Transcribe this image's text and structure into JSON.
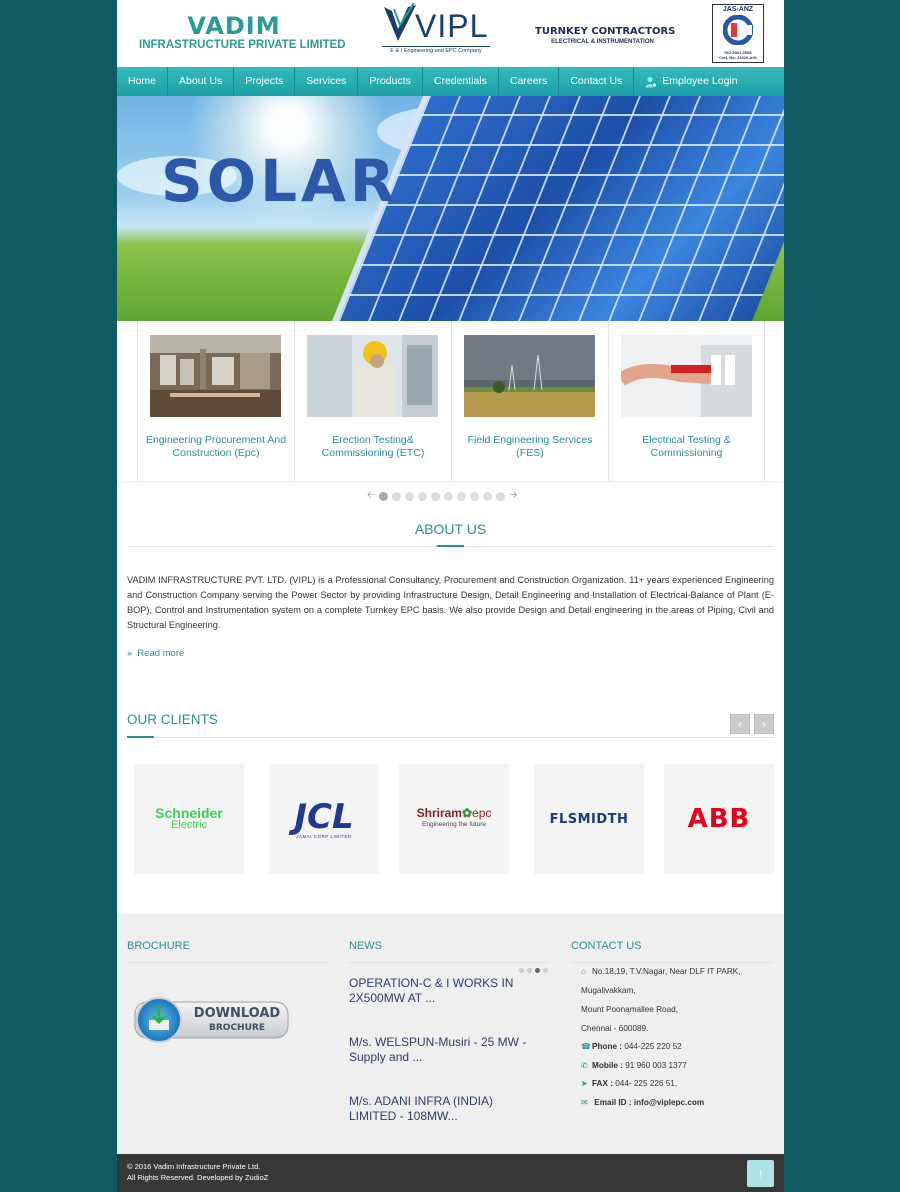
{
  "header": {
    "logo_main": "VADIM",
    "logo_sub": "INFRASTRUCTURE PRIVATE LIMITED",
    "vipl_logo": "VIPL",
    "vipl_sub": "E & I Engineering and EPC Company",
    "turnkey_line1": "TURNKEY CONTRACTORS",
    "turnkey_line2": "ELECTRICAL & INSTRUMENTATION",
    "iso_top": "JAS-ANZ",
    "iso_bottom1": "ISO 9001:2008",
    "iso_bottom2": "Cert. No: 31929-A01"
  },
  "nav": {
    "items": [
      {
        "label": "Home"
      },
      {
        "label": "About Us"
      },
      {
        "label": "Projects"
      },
      {
        "label": "Services"
      },
      {
        "label": "Products"
      },
      {
        "label": "Credentials"
      },
      {
        "label": "Careers"
      },
      {
        "label": "Contact Us"
      },
      {
        "label": "Employee Login",
        "icon": "user-icon"
      }
    ]
  },
  "hero": {
    "title": "SOLAR"
  },
  "services": [
    {
      "label": "Engineering Procurement And Construction (Epc)"
    },
    {
      "label": "Erection Testing& Commissioning (ETC)"
    },
    {
      "label": "Field Engineering Services (FES)"
    },
    {
      "label": "Electrical Testing & Commissioning"
    }
  ],
  "carousel": {
    "dot_count": 10,
    "active_index": 0,
    "prev_icon": "arrow-left-icon",
    "next_icon": "arrow-right-icon"
  },
  "about": {
    "title": "ABOUT US",
    "text": "VADIM INFRASTRUCTURE PVT. LTD. (VIPL) is a Professional Consultancy, Procurement and Construction Organization. 11+ years experienced Engineering and Construction Company serving the Power Sector by providing Infrastructure Design, Detail Engineering and Installation of Electrical-Balance of Plant (E-BOP), Control and Instrumentation system on a complete Turnkey EPC basis. We also provide Design and Detail engineering in the areas of Piping, Civil and Structural Engineering.",
    "read_more": "Read more"
  },
  "clients": {
    "title": "OUR CLIENTS",
    "logos": [
      {
        "line1": "Schneider",
        "line2": "Electric",
        "color": "#3dcd58"
      },
      {
        "line1": "JCL",
        "line2": "JAMAI CORP LIMITED",
        "color": "#1f3a8f"
      },
      {
        "line1": "Shriram",
        "line1b": "epc",
        "line2": "Engineering the future",
        "color": "#8a1f1f"
      },
      {
        "line1": "FLSMIDTH",
        "color": "#1a3b7a"
      },
      {
        "line1": "ABB",
        "color": "#e4001b"
      }
    ]
  },
  "footer": {
    "brochure_title": "BROCHURE",
    "download_line1": "DOWNLOAD",
    "download_line2": "BROCHURE",
    "news_title": "NEWS",
    "news": [
      "OPERATION-C & I WORKS IN 2X500MW AT ...",
      "M/s. WELSPUN-Musiri - 25 MW - Supply and ...",
      "M/s. ADANI INFRA (INDIA) LIMITED - 108MW..."
    ],
    "contact_title": "CONTACT US",
    "address": [
      "No.18,19, T.V.Nagar, Near DLF IT PARK,",
      "Mugalivakkam,",
      "Mount Poonamallee Road,",
      "Chennai - 600089."
    ],
    "phone_label": "Phone :",
    "phone": "044-225 220 52",
    "mobile_label": "Mobile :",
    "mobile": "91 960 003 1377",
    "fax_label": "FAX :",
    "fax": "044- 225 226 51,",
    "email_label": "Email ID :",
    "email": "info@viplepc.com"
  },
  "bottom": {
    "copyright": "© 2016 Vadim Infrastructure Private Ltd.",
    "rights": "All Rights Reserved.  Developed by ZudioZ",
    "to_top_icon": "arrow-up-icon"
  },
  "colors": {
    "accent": "#2a8e95",
    "nav": "#23a8ad",
    "background": "#0d5a60",
    "footer_bar": "#373737"
  }
}
